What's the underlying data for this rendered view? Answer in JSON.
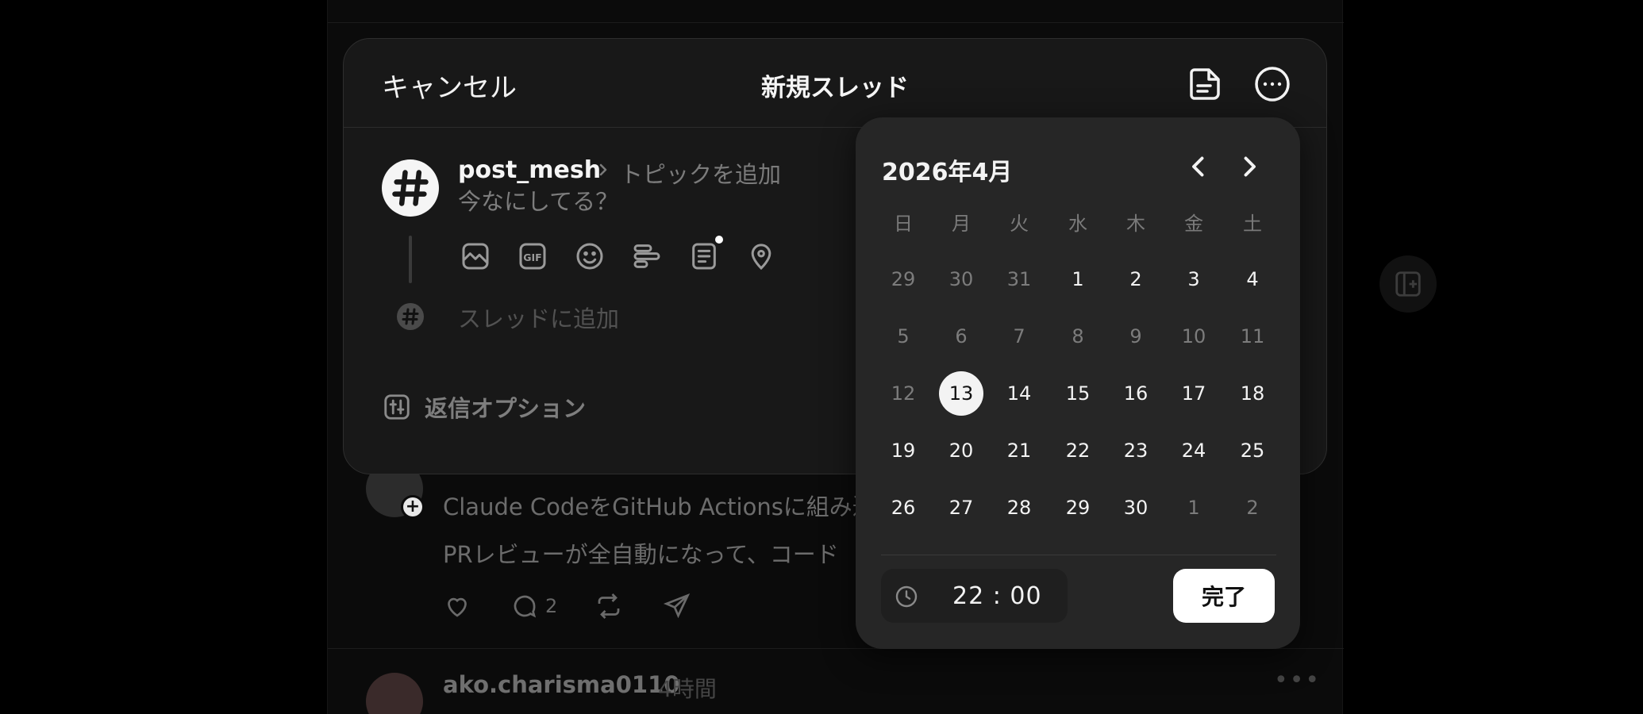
{
  "composer": {
    "cancel_label": "キャンセル",
    "title": "新規スレッド",
    "username": "post_mesh",
    "topic_placeholder": "トピックを追加",
    "body_placeholder": "今なにしてる？",
    "add_thread_placeholder": "スレッドに追加",
    "reply_options_label": "返信オプション"
  },
  "datepicker": {
    "month_label": "2026年4月",
    "weekdays": [
      "日",
      "月",
      "火",
      "水",
      "木",
      "金",
      "土"
    ],
    "weeks": [
      [
        "29",
        "30",
        "31",
        "1",
        "2",
        "3",
        "4"
      ],
      [
        "5",
        "6",
        "7",
        "8",
        "9",
        "10",
        "11"
      ],
      [
        "12",
        "13",
        "14",
        "15",
        "16",
        "17",
        "18"
      ],
      [
        "19",
        "20",
        "21",
        "22",
        "23",
        "24",
        "25"
      ],
      [
        "26",
        "27",
        "28",
        "29",
        "30",
        "1",
        "2"
      ]
    ],
    "selected_day": "13",
    "time": "22 : 00",
    "done_label": "完了"
  },
  "feed": {
    "post1": {
      "line1": "Claude CodeをGitHub Actionsに組み込",
      "line2": "PRレビューが全自動になって、コード",
      "reply_count": "2"
    },
    "post2": {
      "username": "ako.charisma0110",
      "time": "4時間"
    }
  }
}
